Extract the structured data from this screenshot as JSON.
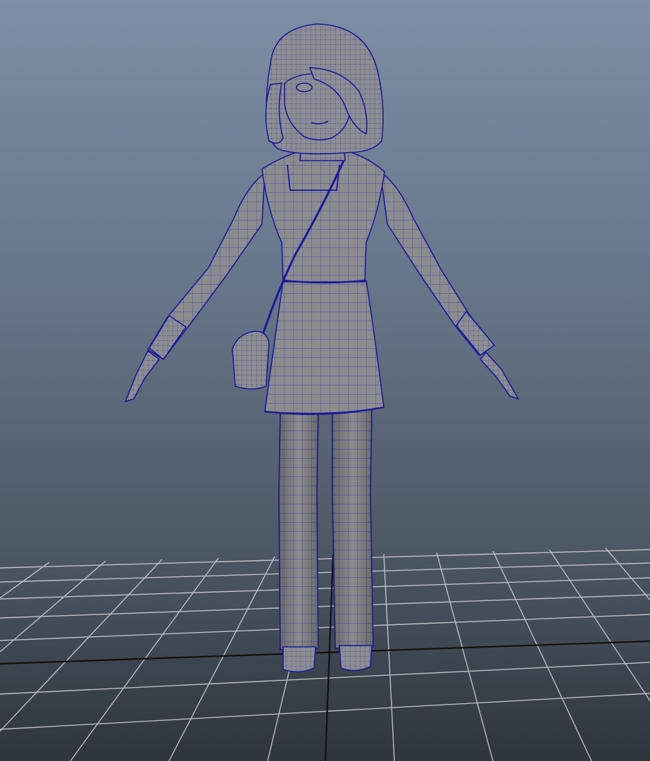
{
  "viewport": {
    "background_top": "#7d8fa6",
    "background_bottom": "#2f353d",
    "grid_line_color": "#c9ccd1",
    "grid_axis_color": "#111111",
    "mesh_fill_color": "#8a8a8e",
    "wireframe_color": "#1a1a9a",
    "icon": "3d-character-wireframe-model"
  }
}
